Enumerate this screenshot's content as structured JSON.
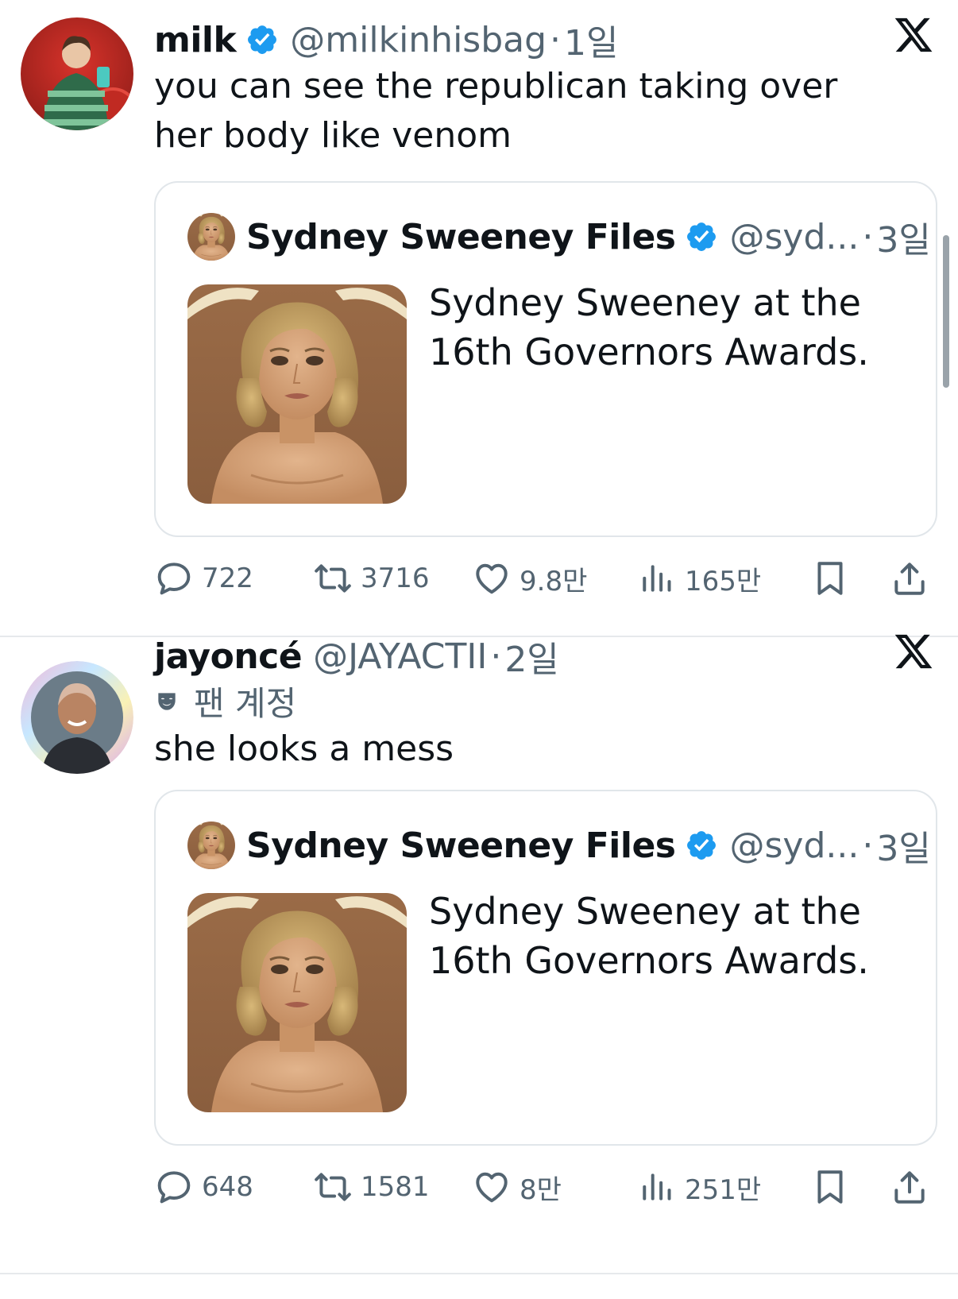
{
  "tweets": [
    {
      "author": {
        "name": "milk",
        "handle": "@milkinhisbag",
        "time": "1일",
        "verified": true
      },
      "text": "you can see the republican taking over her body like venom",
      "quote": {
        "name": "Sydney Sweeney Files",
        "handle": "@syd...",
        "time": "3일",
        "text": "Sydney Sweeney at the 16th Governors Awards."
      },
      "stats": {
        "replies": "722",
        "reposts": "3716",
        "likes": "9.8만",
        "views": "165만"
      }
    },
    {
      "author": {
        "name": "jayoncé",
        "handle": "@JAYACTII",
        "time": "2일",
        "verified": false
      },
      "badge": "팬 계정",
      "text": "she looks a mess",
      "quote": {
        "name": "Sydney Sweeney Files",
        "handle": "@syd...",
        "time": "3일",
        "text": "Sydney Sweeney at the 16th Governors Awards."
      },
      "stats": {
        "replies": "648",
        "reposts": "1581",
        "likes": "8만",
        "views": "251만"
      }
    }
  ],
  "colors": {
    "verified": "#1d9bf0",
    "muted": "#536471",
    "text": "#0f1419",
    "border": "#e1e6ea"
  },
  "icons": [
    "x-logo-icon",
    "verified-badge-icon",
    "reply-icon",
    "repost-icon",
    "like-icon",
    "views-icon",
    "bookmark-icon",
    "share-icon",
    "fan-account-mask-icon"
  ]
}
